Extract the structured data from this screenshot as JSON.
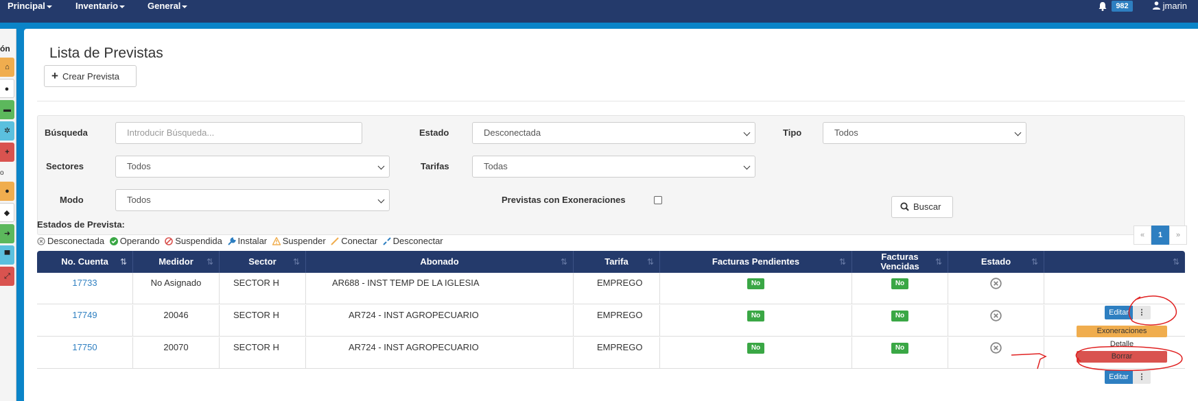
{
  "navbar": {
    "menus": [
      "Principal",
      "Inventario",
      "General"
    ],
    "notification_count": "982",
    "user": "jmarin"
  },
  "sidebar": {
    "label": "ón",
    "buttons": [
      {
        "icon": "home-icon",
        "color": "#f0ad4e"
      },
      {
        "icon": "map-marker-icon",
        "color": "#ffffff"
      },
      {
        "icon": "print-icon",
        "color": "#5cb85c"
      },
      {
        "icon": "gear-icon",
        "color": "#5bc0de"
      },
      {
        "icon": "plus-icon",
        "color": "#d9534f"
      },
      {
        "icon": "user-icon",
        "color": "#f0ad4e"
      },
      {
        "icon": "tag-icon",
        "color": "#ffffff"
      },
      {
        "icon": "arrow-right-icon",
        "color": "#5cb85c"
      },
      {
        "icon": "truck-icon",
        "color": "#5bc0de"
      },
      {
        "icon": "expand-icon",
        "color": "#d9534f"
      }
    ]
  },
  "page": {
    "title": "Lista de Previstas",
    "create_button": "Crear Prevista"
  },
  "filters": {
    "search_label": "Búsqueda",
    "search_placeholder": "Introducir Búsqueda...",
    "estado_label": "Estado",
    "estado_value": "Desconectada",
    "tipo_label": "Tipo",
    "tipo_value": "Todos",
    "sectores_label": "Sectores",
    "sectores_value": "Todos",
    "tarifas_label": "Tarifas",
    "tarifas_value": "Todas",
    "modo_label": "Modo",
    "modo_value": "Todos",
    "exoneraciones_label": "Previstas con Exoneraciones",
    "search_button": "Buscar"
  },
  "estados": {
    "title": "Estados de Prevista:",
    "legend": [
      {
        "label": "Desconectada",
        "color": "#888888",
        "icon": "circle-x-icon"
      },
      {
        "label": "Operando",
        "color": "#3aa745",
        "icon": "check-circle-icon"
      },
      {
        "label": "Suspendida",
        "color": "#d9534f",
        "icon": "ban-icon"
      },
      {
        "label": "Instalar",
        "color": "#2e7fc1",
        "icon": "wrench-icon"
      },
      {
        "label": "Suspender",
        "color": "#f0ad4e",
        "icon": "warning-icon"
      },
      {
        "label": "Conectar",
        "color": "#f0ad4e",
        "icon": "plug-icon"
      },
      {
        "label": "Desconectar",
        "color": "#2e7fc1",
        "icon": "unplug-icon"
      }
    ]
  },
  "pagination": {
    "prev": "«",
    "current": "1",
    "next": "»"
  },
  "table": {
    "headers": [
      "No. Cuenta",
      "Medidor",
      "Sector",
      "Abonado",
      "Tarifa",
      "Facturas Pendientes",
      "Facturas Vencidas",
      "Estado",
      ""
    ],
    "rows": [
      {
        "cuenta": "17733",
        "medidor": "No Asignado",
        "sector": "SECTOR H",
        "abonado": "AR688 - INST TEMP DE LA IGLESIA",
        "tarifa": "EMPREGO",
        "pendientes": "No",
        "vencidas": "No"
      },
      {
        "cuenta": "17749",
        "medidor": "20046",
        "sector": "SECTOR H",
        "abonado": "AR724 - INST AGROPECUARIO",
        "tarifa": "EMPREGO",
        "pendientes": "No",
        "vencidas": "No"
      },
      {
        "cuenta": "17750",
        "medidor": "20070",
        "sector": "SECTOR H",
        "abonado": "AR724 - INST AGROPECUARIO",
        "tarifa": "EMPREGO",
        "pendientes": "No",
        "vencidas": "No"
      }
    ],
    "edit_label": "Editar",
    "more_label": "⋮"
  },
  "dropdown": {
    "exoneraciones": "Exoneraciones",
    "detalle": "Detalle",
    "borrar": "Borrar"
  }
}
